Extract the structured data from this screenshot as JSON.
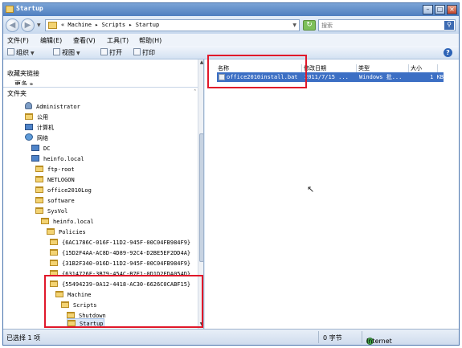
{
  "window": {
    "title": "Startup"
  },
  "title_buttons": {
    "minimize": "–",
    "maximize": "□",
    "close": "×"
  },
  "nav": {
    "back_label": "◀",
    "forward_label": "▶",
    "address_crumbs": "« Machine ▸ Scripts ▸ Startup",
    "search_placeholder": "搜索"
  },
  "menu": [
    "文件(F)",
    "编辑(E)",
    "查看(V)",
    "工具(T)",
    "帮助(H)"
  ],
  "toolbar": {
    "organize": "组织",
    "views": "视图",
    "open": "打开",
    "print": "打印"
  },
  "left_pane": {
    "favorites_header": "收藏夹链接",
    "favorites_cut": "更多 »",
    "folders_header": "文件夹",
    "tree": [
      {
        "label": "Administrator",
        "icon": "user-folder-icon"
      },
      {
        "label": "公用",
        "icon": "folder-icon"
      },
      {
        "label": "计算机",
        "icon": "computer-icon"
      },
      {
        "label": "网络",
        "icon": "network-icon"
      },
      {
        "label": "DC",
        "icon": "computer-icon"
      },
      {
        "label": "heinfo.local",
        "icon": "computer-icon"
      },
      {
        "label": "ftp-root",
        "icon": "folder-icon"
      },
      {
        "label": "NETLOGON",
        "icon": "folder-icon"
      },
      {
        "label": "office2010Log",
        "icon": "folder-icon"
      },
      {
        "label": "software",
        "icon": "folder-icon"
      },
      {
        "label": "SysVol",
        "icon": "folder-icon"
      },
      {
        "label": "heinfo.local",
        "icon": "folder-icon"
      },
      {
        "label": "Policies",
        "icon": "folder-icon"
      },
      {
        "label": "{6AC1786C-016F-11D2-945F-00C04FB984F9}",
        "icon": "folder-icon"
      },
      {
        "label": "{15D2F4AA-AC8D-4D89-92C4-D2BE5EF2DD4A}",
        "icon": "folder-icon"
      },
      {
        "label": "{31B2F340-016D-11D2-945F-00C04FB984F9}",
        "icon": "folder-icon"
      },
      {
        "label": "{6314726F-3B79-454C-B7E1-0D1D2FDA054D}",
        "icon": "folder-icon"
      },
      {
        "label": "{55494239-0A12-4418-AC30-6626C0CABF15}",
        "icon": "folder-icon"
      },
      {
        "label": "Machine",
        "icon": "folder-icon"
      },
      {
        "label": "Scripts",
        "icon": "folder-icon"
      },
      {
        "label": "Shutdown",
        "icon": "folder-icon"
      },
      {
        "label": "Startup",
        "icon": "folder-icon"
      }
    ]
  },
  "file_list": {
    "columns": [
      "名称",
      "修改日期",
      "类型",
      "大小"
    ],
    "rows": [
      {
        "name": "office2010install.bat",
        "date": "2011/7/15 ...",
        "type": "Windows 批...",
        "size": "1 KB"
      }
    ]
  },
  "status": {
    "selected": "已选择 1 项",
    "bytes": "0 字节",
    "zone": "Internet"
  },
  "colors": {
    "annotation": "#e0182a",
    "selection": "#3c6fc4",
    "titlebar": "#5a86c4"
  }
}
